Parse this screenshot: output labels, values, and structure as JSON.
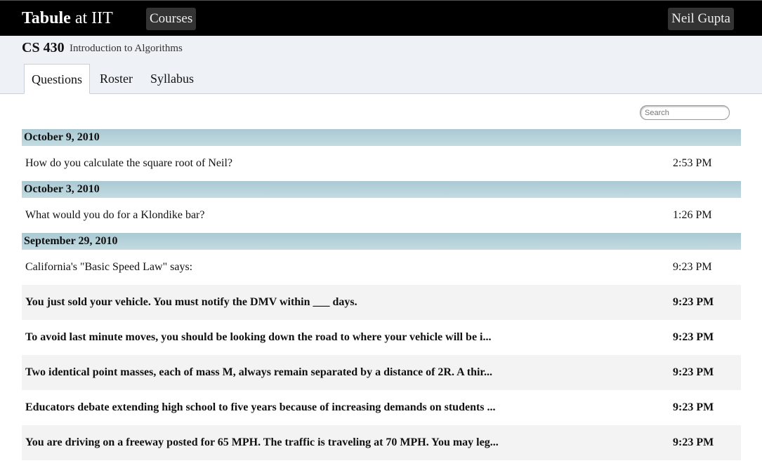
{
  "header": {
    "brand_bold": "Tabule",
    "brand_rest": " at IIT",
    "courses_label": "Courses",
    "user_name": "Neil Gupta"
  },
  "course": {
    "code": "CS 430",
    "name": "Introduction to Algorithms"
  },
  "tabs": [
    {
      "label": "Questions",
      "active": true
    },
    {
      "label": "Roster",
      "active": false
    },
    {
      "label": "Syllabus",
      "active": false
    }
  ],
  "search": {
    "placeholder": "Search"
  },
  "groups": [
    {
      "date": "October 9, 2010",
      "items": [
        {
          "question": "How do you calculate the square root of Neil?",
          "time": "2:53 PM",
          "unread": false
        }
      ]
    },
    {
      "date": "October 3, 2010",
      "items": [
        {
          "question": "What would you do for a Klondike bar?",
          "time": "1:26 PM",
          "unread": false
        }
      ]
    },
    {
      "date": "September 29, 2010",
      "items": [
        {
          "question": "California's \"Basic Speed Law\" says:",
          "time": "9:23 PM",
          "unread": false
        },
        {
          "question": "You just sold your vehicle. You must notify the DMV within ___ days.",
          "time": "9:23 PM",
          "unread": true
        },
        {
          "question": "To avoid last minute moves, you should be looking down the road to where your vehicle will be i...",
          "time": "9:23 PM",
          "unread": true
        },
        {
          "question": "Two identical point masses, each of mass M, always remain separated by a distance of 2R. A thir...",
          "time": "9:23 PM",
          "unread": true
        },
        {
          "question": "Educators debate extending high school to five years because of increasing demands on students ...",
          "time": "9:23 PM",
          "unread": true
        },
        {
          "question": "You are driving on a freeway posted for 65 MPH. The traffic is traveling at 70 MPH. You may leg...",
          "time": "9:23 PM",
          "unread": true
        }
      ]
    }
  ]
}
